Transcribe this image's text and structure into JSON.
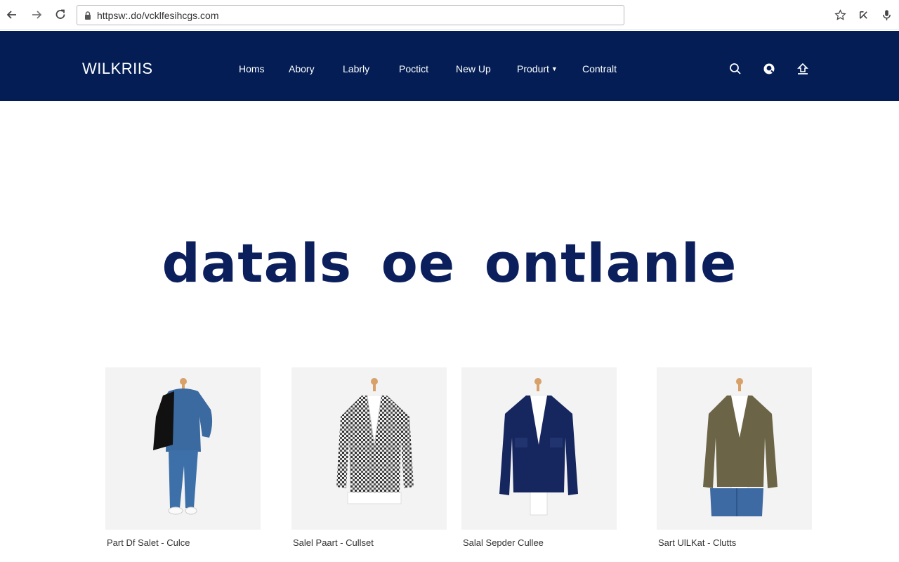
{
  "browser": {
    "url": "httpsw:.do/vcklfesihcgs.com",
    "icons": [
      "back-icon",
      "forward-icon",
      "reload-icon",
      "lock-icon",
      "star-icon",
      "extension-icon",
      "microphone-icon"
    ]
  },
  "header": {
    "logo": "WILKRIIS",
    "nav": [
      {
        "label": "Homs"
      },
      {
        "label": "Abory"
      },
      {
        "label": "Labrly"
      },
      {
        "label": "Poctict"
      },
      {
        "label": "New Up"
      },
      {
        "label": "Produrt",
        "has_dropdown": true
      },
      {
        "label": "Contralt"
      }
    ],
    "icons": [
      "search-icon",
      "account-icon",
      "cart-icon"
    ],
    "background": "#041e55"
  },
  "hero": {
    "title": "datals oe ontlanle",
    "color": "#0a1f5c"
  },
  "products": [
    {
      "caption": "Part Df Salet - Culce",
      "image": "denim-outfit-with-black-jacket"
    },
    {
      "caption": "Salel Paart - Cullset",
      "image": "houndstooth-blazer"
    },
    {
      "caption": "Salal Sepder Cullee",
      "image": "navy-jacket"
    },
    {
      "caption": "Sart UlLKat - Clutts",
      "image": "olive-jacket-with-denim-shorts"
    }
  ]
}
